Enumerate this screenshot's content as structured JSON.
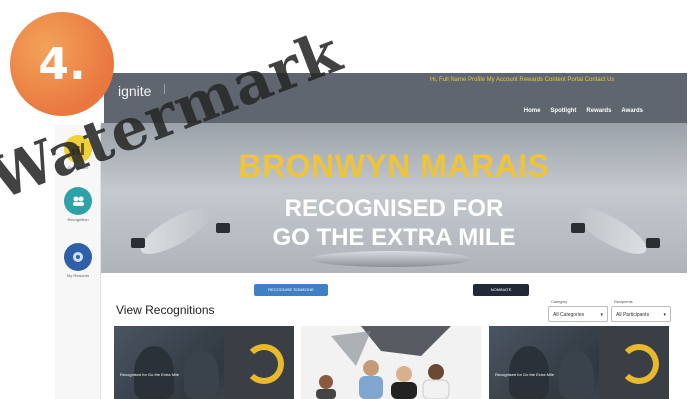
{
  "step_number": "4.",
  "watermark_text": "Watermark",
  "header": {
    "logo": "ignite",
    "top_links": "Hi, Full Name   Profile   My Account   Rewards   Content Portal   Contact Us",
    "nav": [
      "Home",
      "Spotlight",
      "Rewards",
      "Awards"
    ]
  },
  "rail": [
    {
      "label": "Dashboard",
      "icon": "chart-icon",
      "color": "#f0d036"
    },
    {
      "label": "Recognition",
      "icon": "people-icon",
      "color": "#2fa2a8"
    },
    {
      "label": "My Rewards",
      "icon": "gift-icon",
      "color": "#2f5fa8"
    }
  ],
  "banner": {
    "name": "BRONWYN MARAIS",
    "line1": "RECOGNISED FOR",
    "line2": "GO THE EXTRA MILE"
  },
  "buttons": {
    "primary": "RECOGNISE SOMEONE",
    "secondary": "NOMINATE"
  },
  "section_title": "View Recognitions",
  "filters": [
    {
      "label": "Category",
      "value": "All Categories"
    },
    {
      "label": "Recipients",
      "value": "All Participants"
    }
  ],
  "cards": [
    {
      "caption": "Recognised for Go the Extra Mile"
    },
    {
      "caption": ""
    },
    {
      "caption": "Recognised for Go the Extra Mile"
    }
  ],
  "colors": {
    "accent": "#e8b92d",
    "header": "#5f6670",
    "badge": "#e9773f"
  }
}
